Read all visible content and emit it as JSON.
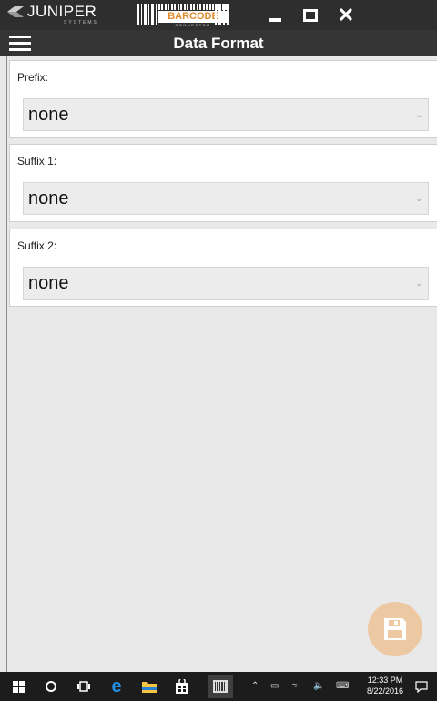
{
  "titlebar": {
    "brand_text": "JUNIPER",
    "brand_sub": "SYSTEMS",
    "barcode_word": "BARCODE",
    "barcode_sub": "CONNECTOR"
  },
  "header": {
    "title": "Data Format"
  },
  "fields": [
    {
      "label": "Prefix:",
      "value": "none"
    },
    {
      "label": "Suffix 1:",
      "value": "none"
    },
    {
      "label": "Suffix 2:",
      "value": "none"
    }
  ],
  "taskbar": {
    "time": "12:33 PM",
    "date": "8/22/2016"
  },
  "colors": {
    "accent": "#e08a2c",
    "fab": "#ecc9a2"
  }
}
